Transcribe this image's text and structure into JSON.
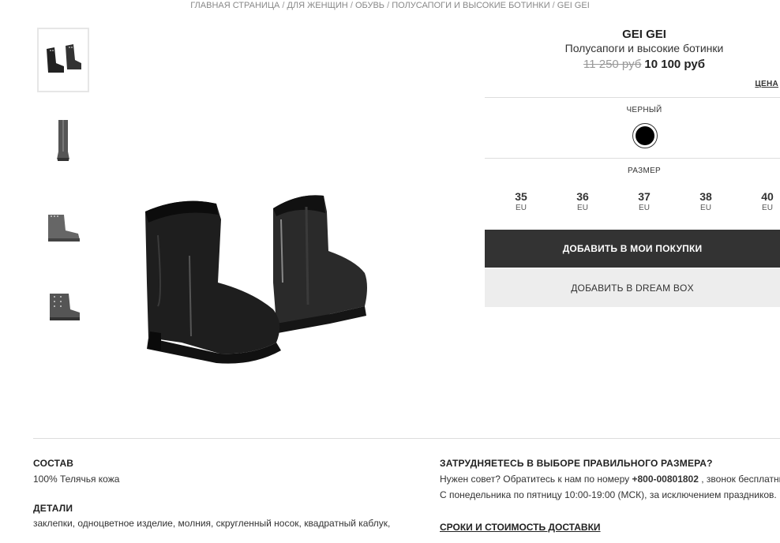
{
  "breadcrumb": {
    "items": [
      "ГЛАВНАЯ СТРАНИЦА",
      "ДЛЯ ЖЕНЩИН",
      "ОБУВЬ",
      "ПОЛУСАПОГИ И ВЫСОКИЕ БОТИНКИ",
      "GEI GEI"
    ],
    "separator": "/"
  },
  "product": {
    "brand": "GEI GEI",
    "category": "Полусапоги и высокие ботинки",
    "old_price": "11 250 руб",
    "new_price": "10 100 руб",
    "price_link": "ЦЕНА"
  },
  "color": {
    "label": "ЧЕРНЫЙ",
    "swatch_hex": "#000000"
  },
  "sizes": {
    "label": "РАЗМЕР",
    "items": [
      {
        "num": "35",
        "unit": "EU"
      },
      {
        "num": "36",
        "unit": "EU"
      },
      {
        "num": "37",
        "unit": "EU"
      },
      {
        "num": "38",
        "unit": "EU"
      },
      {
        "num": "40",
        "unit": "EU"
      }
    ]
  },
  "actions": {
    "add_to_cart": "ДОБАВИТЬ В МОИ ПОКУПКИ",
    "add_to_dreambox": "ДОБАВИТЬ В DREAM BOX"
  },
  "composition": {
    "title": "СОСТАВ",
    "text": "100% Телячья кожа"
  },
  "details": {
    "title": "ДЕТАЛИ",
    "text": "заклепки, одноцветное изделие, молния, скругленный носок, квадратный каблук,"
  },
  "size_help": {
    "title": "ЗАТРУДНЯЕТЕСЬ В ВЫБОРЕ ПРАВИЛЬНОГО РАЗМЕРА?",
    "line1_prefix": "Нужен совет? Обратитесь к нам по номеру",
    "phone": "+800-00801802",
    "line1_suffix": ", звонок бесплатный",
    "line2": "С понедельника по пятницу 10:00-19:00 (МСК), за исключением праздников."
  },
  "delivery": {
    "title": "СРОКИ И СТОИМОСТЬ ДОСТАВКИ"
  },
  "thumbnails": [
    "boots-pair-thumbnail",
    "boot-front-thumbnail",
    "boot-side-thumbnail",
    "boot-back-thumbnail"
  ]
}
